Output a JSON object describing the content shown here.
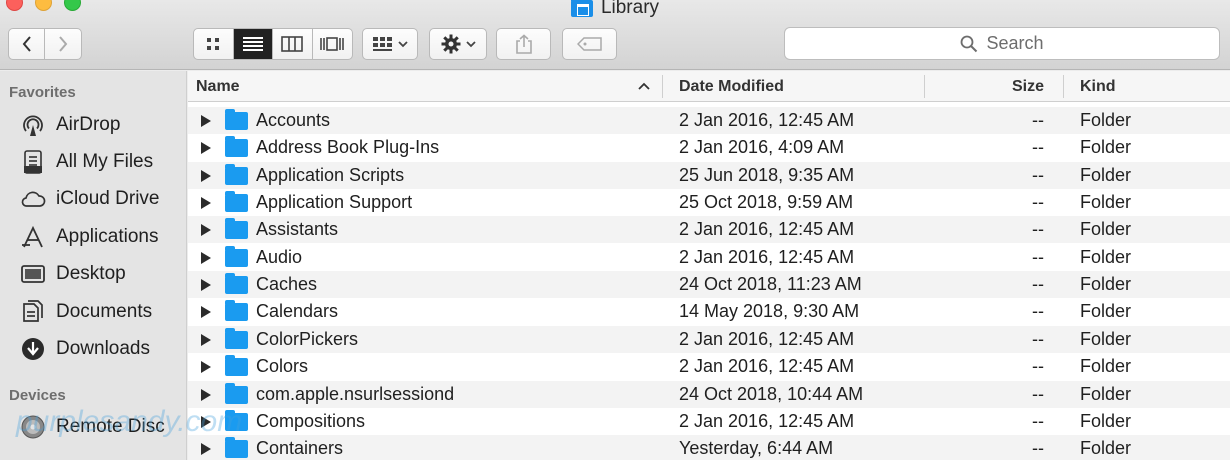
{
  "window": {
    "title": "Library"
  },
  "toolbar": {
    "back_icon": "chevron-left-icon",
    "forward_icon": "chevron-right-icon",
    "view_icons": [
      "icon-view-icon",
      "list-view-icon",
      "column-view-icon",
      "coverflow-view-icon"
    ],
    "arrange_icon": "arrange-grid-icon",
    "action_icon": "gear-icon",
    "share_icon": "share-icon",
    "tag_icon": "tag-icon"
  },
  "search": {
    "label": "Search"
  },
  "sidebar": {
    "favorites_header": "Favorites",
    "favorites": [
      {
        "label": "AirDrop",
        "icon": "airdrop-icon"
      },
      {
        "label": "All My Files",
        "icon": "all-files-icon"
      },
      {
        "label": "iCloud Drive",
        "icon": "cloud-icon"
      },
      {
        "label": "Applications",
        "icon": "applications-icon"
      },
      {
        "label": "Desktop",
        "icon": "desktop-icon"
      },
      {
        "label": "Documents",
        "icon": "documents-icon"
      },
      {
        "label": "Downloads",
        "icon": "download-icon"
      }
    ],
    "devices_header": "Devices",
    "devices": [
      {
        "label": "Remote Disc",
        "icon": "disc-icon"
      }
    ]
  },
  "columns": {
    "name": "Name",
    "date": "Date Modified",
    "size": "Size",
    "kind": "Kind"
  },
  "files": [
    {
      "name": "Accounts",
      "date": "2 Jan 2016, 12:45 AM",
      "size": "--",
      "kind": "Folder"
    },
    {
      "name": "Address Book Plug-Ins",
      "date": "2 Jan 2016, 4:09 AM",
      "size": "--",
      "kind": "Folder"
    },
    {
      "name": "Application Scripts",
      "date": "25 Jun 2018, 9:35 AM",
      "size": "--",
      "kind": "Folder"
    },
    {
      "name": "Application Support",
      "date": "25 Oct 2018, 9:59 AM",
      "size": "--",
      "kind": "Folder"
    },
    {
      "name": "Assistants",
      "date": "2 Jan 2016, 12:45 AM",
      "size": "--",
      "kind": "Folder"
    },
    {
      "name": "Audio",
      "date": "2 Jan 2016, 12:45 AM",
      "size": "--",
      "kind": "Folder"
    },
    {
      "name": "Caches",
      "date": "24 Oct 2018, 11:23 AM",
      "size": "--",
      "kind": "Folder"
    },
    {
      "name": "Calendars",
      "date": "14 May 2018, 9:30 AM",
      "size": "--",
      "kind": "Folder"
    },
    {
      "name": "ColorPickers",
      "date": "2 Jan 2016, 12:45 AM",
      "size": "--",
      "kind": "Folder"
    },
    {
      "name": "Colors",
      "date": "2 Jan 2016, 12:45 AM",
      "size": "--",
      "kind": "Folder"
    },
    {
      "name": "com.apple.nsurlsessiond",
      "date": "24 Oct 2018, 10:44 AM",
      "size": "--",
      "kind": "Folder"
    },
    {
      "name": "Compositions",
      "date": "2 Jan 2016, 12:45 AM",
      "size": "--",
      "kind": "Folder"
    },
    {
      "name": "Containers",
      "date": "Yesterday, 6:44 AM",
      "size": "--",
      "kind": "Folder"
    }
  ],
  "watermark": "purplesandy.com"
}
